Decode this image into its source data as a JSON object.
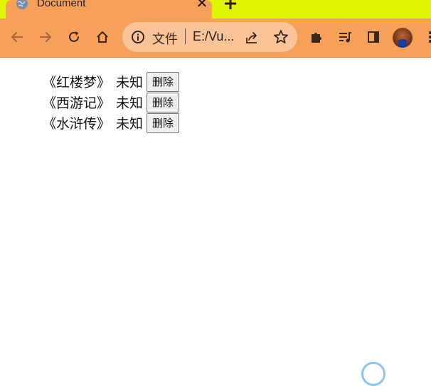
{
  "tab": {
    "title": "Document",
    "close_icon": "close-icon",
    "favicon": "globe-icon"
  },
  "toolbar": {
    "back_icon": "arrow-left-icon",
    "forward_icon": "arrow-right-icon",
    "reload_icon": "reload-icon",
    "home_icon": "home-icon",
    "extensions_icon": "puzzle-icon",
    "media_icon": "media-queue-icon",
    "sidepanel_icon": "side-panel-icon"
  },
  "omnibox": {
    "scheme_label": "文件",
    "url": "E:/Vu..."
  },
  "books": [
    {
      "title": "《红楼梦》",
      "author": "未知",
      "delete_label": "删除"
    },
    {
      "title": "《西游记》",
      "author": "未知",
      "delete_label": "删除"
    },
    {
      "title": "《水浒传》",
      "author": "未知",
      "delete_label": "删除"
    }
  ],
  "colors": {
    "tabstrip_bg": "#dff500",
    "toolbar_bg": "#f7a05a",
    "omnibox_bg": "#fbc398"
  }
}
